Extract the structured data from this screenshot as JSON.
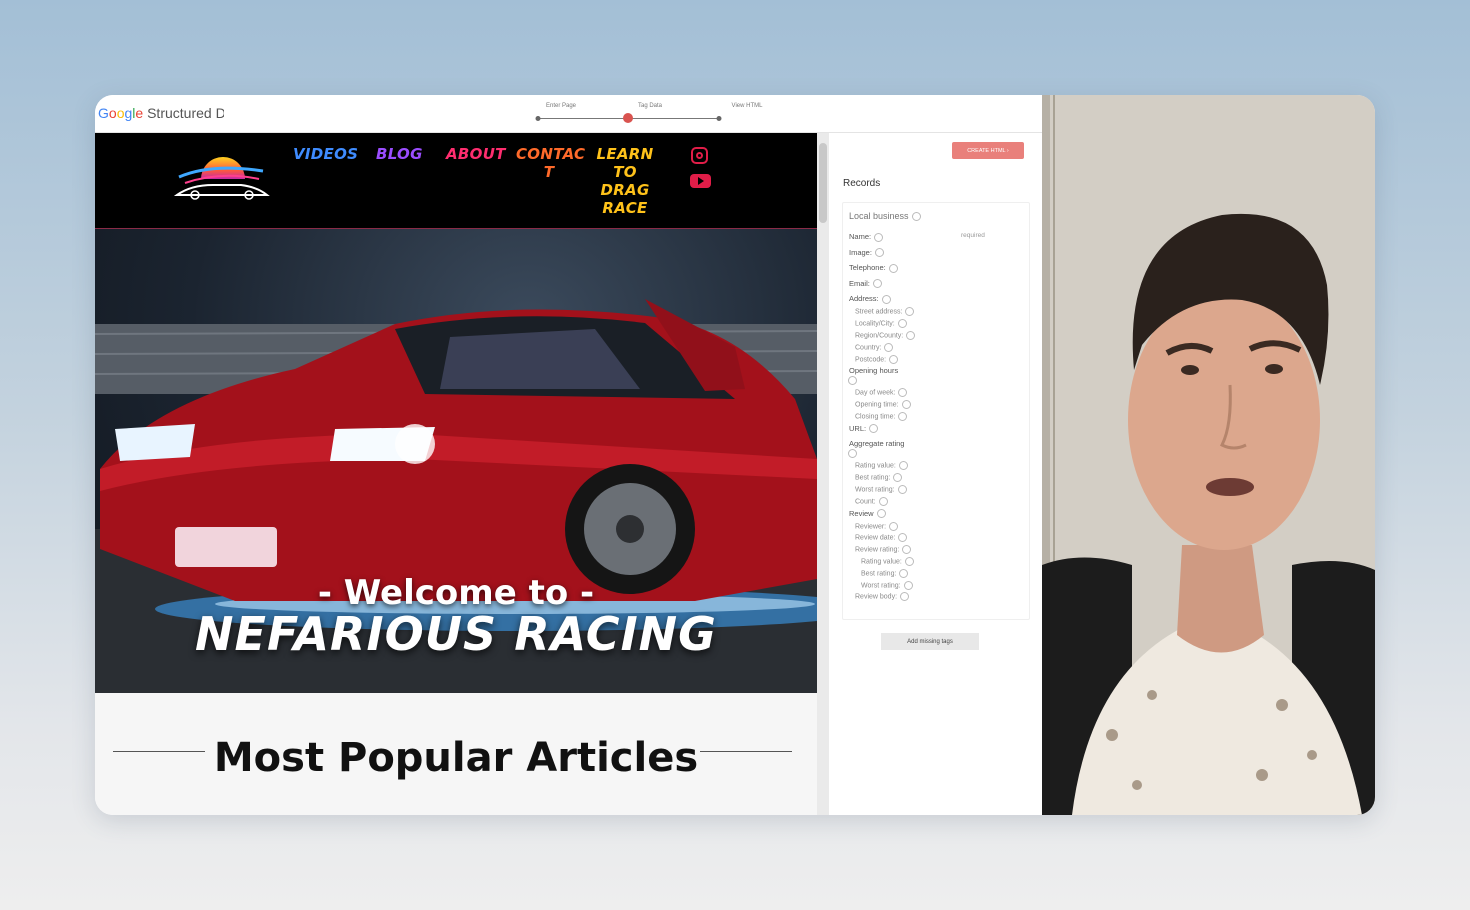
{
  "tool": {
    "logo_google": [
      "G",
      "o",
      "o",
      "g",
      "l",
      "e"
    ],
    "logo_rest": " Structured D",
    "steps": [
      "Enter Page",
      "Tag Data",
      "View HTML"
    ],
    "active_step": "Tag Data"
  },
  "site": {
    "nav": [
      "VIDEOS",
      "BLOG",
      "ABOUT",
      "CONTAC\nT",
      "LEARN\nTO\nDRAG\nRACE"
    ],
    "nav_colors": [
      "#3f8cff",
      "#9b4dff",
      "#ff2d6f",
      "#ff6a2a",
      "#ffc21a"
    ],
    "hero_welcome": "- Welcome to -",
    "hero_brand": "NEFARIOUS RACING",
    "articles_title": "Most Popular Articles",
    "social_icons": [
      "instagram-icon",
      "youtube-icon"
    ]
  },
  "panel": {
    "create_button": "CREATE HTML",
    "records_title": "Records",
    "section": "Local business",
    "required": "required",
    "fields": [
      {
        "label": "Name:"
      },
      {
        "label": "Image:"
      },
      {
        "label": "Telephone:"
      },
      {
        "label": "Email:"
      },
      {
        "label": "Address:"
      },
      {
        "label": "Street address:",
        "sub": 1
      },
      {
        "label": "Locality/City:",
        "sub": 1
      },
      {
        "label": "Region/County:",
        "sub": 1
      },
      {
        "label": "Country:",
        "sub": 1
      },
      {
        "label": "Postcode:",
        "sub": 1
      },
      {
        "label": "Opening hours"
      },
      {
        "label": "Day of week:",
        "sub": 1
      },
      {
        "label": "Opening time:",
        "sub": 1
      },
      {
        "label": "Closing time:",
        "sub": 1
      },
      {
        "label": "URL:"
      },
      {
        "label": "Aggregate rating"
      },
      {
        "label": "Rating value:",
        "sub": 1
      },
      {
        "label": "Best rating:",
        "sub": 1
      },
      {
        "label": "Worst rating:",
        "sub": 1
      },
      {
        "label": "Count:",
        "sub": 1
      },
      {
        "label": "Review"
      },
      {
        "label": "Reviewer:",
        "sub": 1
      },
      {
        "label": "Review date:",
        "sub": 1
      },
      {
        "label": "Review rating:",
        "sub": 1
      },
      {
        "label": "Rating value:",
        "sub": 2
      },
      {
        "label": "Best rating:",
        "sub": 2
      },
      {
        "label": "Worst rating:",
        "sub": 2
      },
      {
        "label": "Review body:",
        "sub": 1
      }
    ],
    "add_button": "Add missing tags"
  }
}
